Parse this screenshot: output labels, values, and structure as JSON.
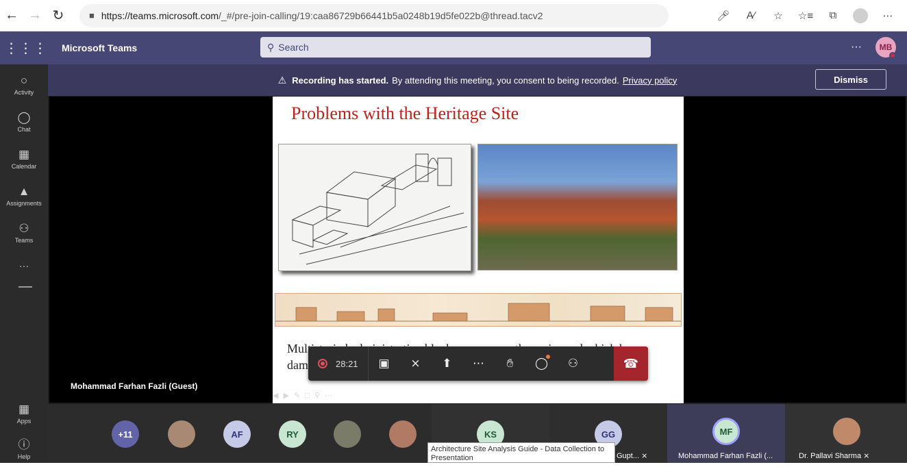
{
  "browser": {
    "url_host": "https://teams.microsoft.com",
    "url_rest": "/_#/pre-join-calling/19:caa86729b66441b5a0248b19d5fe022b@thread.tacv2"
  },
  "header": {
    "app_name": "Microsoft Teams",
    "search_placeholder": "Search",
    "more": "···",
    "avatar_initials": "MB"
  },
  "rail": {
    "items": [
      {
        "label": "Activity"
      },
      {
        "label": "Chat"
      },
      {
        "label": "Calendar"
      },
      {
        "label": "Assignments"
      },
      {
        "label": "Teams"
      }
    ],
    "more": "···",
    "apps": "Apps",
    "help": "Help"
  },
  "banner": {
    "bold": "Recording has started.",
    "text": "By attending this meeting, you consent to being recorded.",
    "link": "Privacy policy",
    "dismiss": "Dismiss"
  },
  "slide": {
    "title": "Problems with the Heritage Site",
    "body": "Multistoried administrative block came up on the main road which has damaged the visual appearance of the heritage buildings."
  },
  "presenter": "Mohammad Farhan Fazli (Guest)",
  "controls": {
    "elapsed": "28:21"
  },
  "participants": [
    {
      "initials": "+11",
      "bg": "#6264a7",
      "fg": "#ffffff"
    },
    {
      "initials": "",
      "bg": "#a88a74",
      "fg": "#ffffff"
    },
    {
      "initials": "AF",
      "bg": "#c5cbe7",
      "fg": "#30327a"
    },
    {
      "initials": "RY",
      "bg": "#c9e6d3",
      "fg": "#1e5b34"
    },
    {
      "initials": "",
      "bg": "#7b7b6a",
      "fg": "#ffffff"
    },
    {
      "initials": "",
      "bg": "#b07a64",
      "fg": "#ffffff"
    },
    {
      "initials": "KS",
      "bg": "#c9e6d3",
      "fg": "#1e5b34"
    },
    {
      "initials": "GG",
      "bg": "#c5cbe7",
      "fg": "#30327a"
    },
    {
      "initials": "MF",
      "bg": "#c9e6d3",
      "fg": "#1e5b34"
    },
    {
      "initials": "",
      "bg": "#c08a6a",
      "fg": "#ffffff"
    }
  ],
  "participant_names": {
    "gg": "Gupt...",
    "mf": "Mohammad Farhan Fazli (...",
    "ps": "Dr. Pallavi Sharma"
  },
  "tooltip": "Architecture Site Analysis Guide - Data Collection to Presentation"
}
